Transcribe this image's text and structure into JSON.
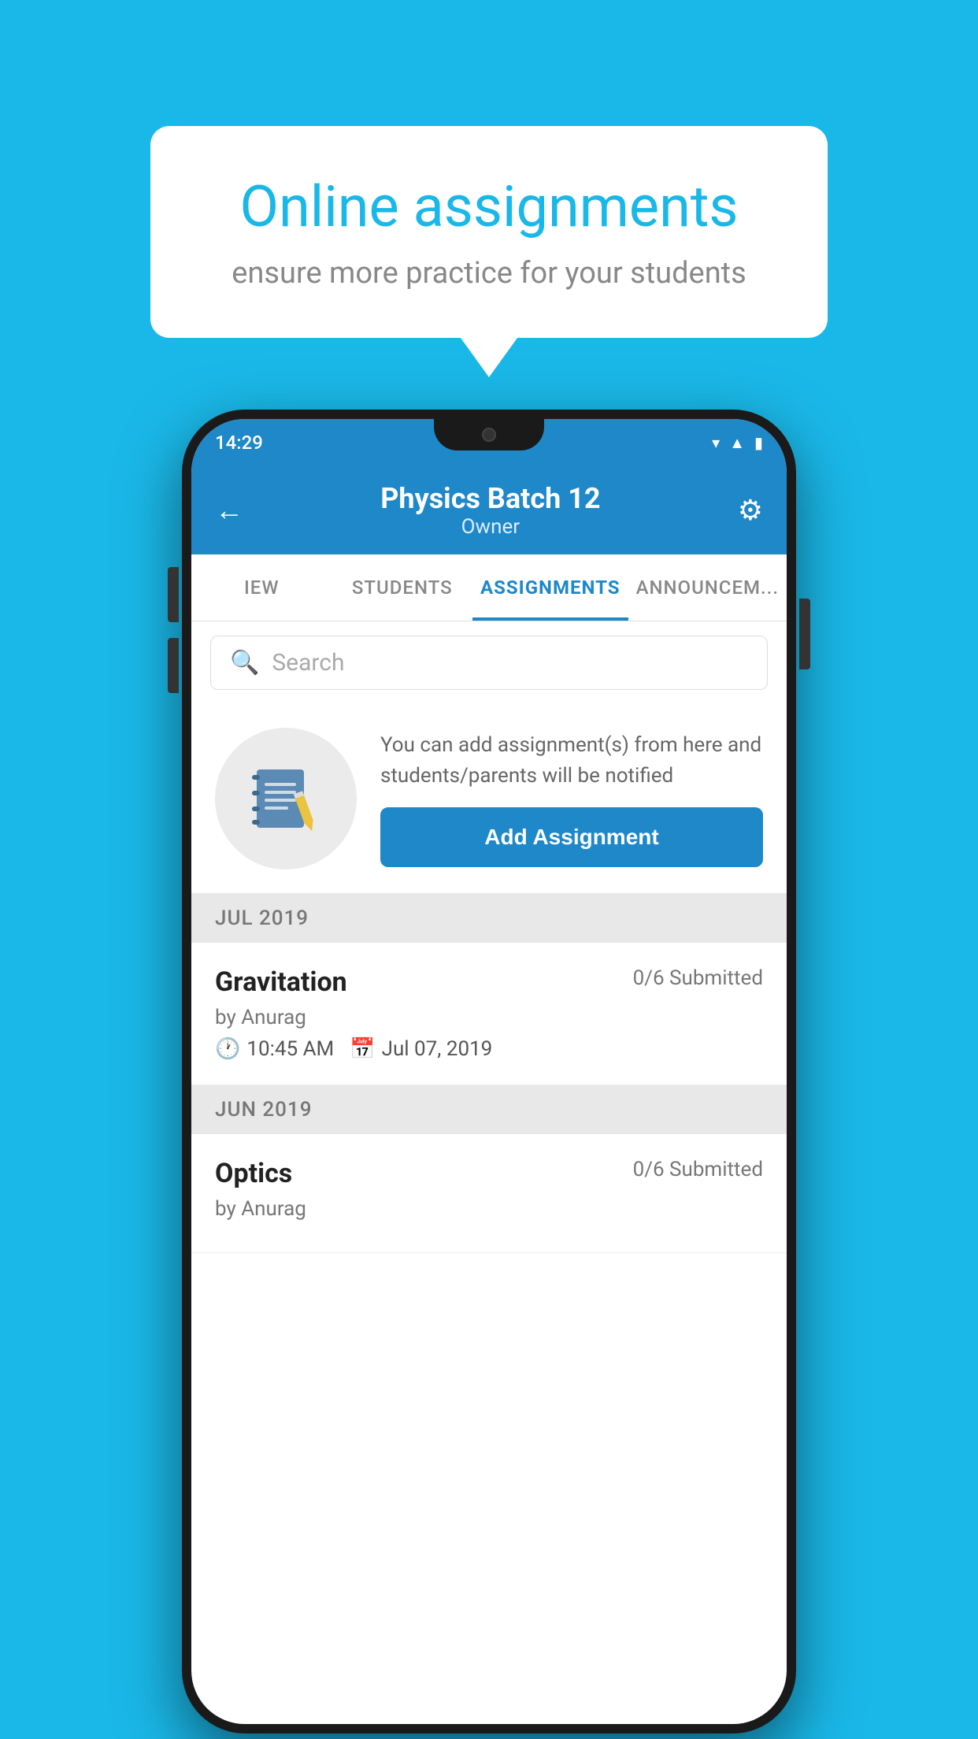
{
  "background_color": "#1ab8e8",
  "speech_bubble": {
    "title": "Online assignments",
    "subtitle": "ensure more practice for your students"
  },
  "phone": {
    "status_bar": {
      "time": "14:29",
      "icons": [
        "wifi",
        "signal",
        "battery"
      ]
    },
    "header": {
      "title": "Physics Batch 12",
      "subtitle": "Owner",
      "back_label": "←",
      "settings_label": "⚙"
    },
    "tabs": [
      {
        "label": "IEW",
        "active": false
      },
      {
        "label": "STUDENTS",
        "active": false
      },
      {
        "label": "ASSIGNMENTS",
        "active": true
      },
      {
        "label": "ANNOUNCEM...",
        "active": false
      }
    ],
    "search": {
      "placeholder": "Search"
    },
    "promo": {
      "description": "You can add assignment(s) from here and students/parents will be notified",
      "button_label": "Add Assignment"
    },
    "sections": [
      {
        "header": "JUL 2019",
        "assignments": [
          {
            "name": "Gravitation",
            "submitted": "0/6 Submitted",
            "author": "by Anurag",
            "time": "10:45 AM",
            "date": "Jul 07, 2019"
          }
        ]
      },
      {
        "header": "JUN 2019",
        "assignments": [
          {
            "name": "Optics",
            "submitted": "0/6 Submitted",
            "author": "by Anurag",
            "time": "",
            "date": ""
          }
        ]
      }
    ]
  }
}
